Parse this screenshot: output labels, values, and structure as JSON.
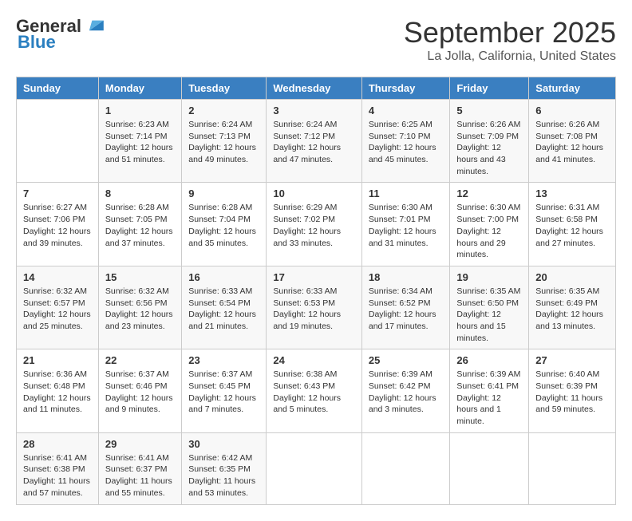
{
  "header": {
    "logo_line1": "General",
    "logo_line2": "Blue",
    "title": "September 2025",
    "subtitle": "La Jolla, California, United States"
  },
  "calendar": {
    "headers": [
      "Sunday",
      "Monday",
      "Tuesday",
      "Wednesday",
      "Thursday",
      "Friday",
      "Saturday"
    ],
    "weeks": [
      [
        {
          "day": "",
          "sunrise": "",
          "sunset": "",
          "daylight": ""
        },
        {
          "day": "1",
          "sunrise": "Sunrise: 6:23 AM",
          "sunset": "Sunset: 7:14 PM",
          "daylight": "Daylight: 12 hours and 51 minutes."
        },
        {
          "day": "2",
          "sunrise": "Sunrise: 6:24 AM",
          "sunset": "Sunset: 7:13 PM",
          "daylight": "Daylight: 12 hours and 49 minutes."
        },
        {
          "day": "3",
          "sunrise": "Sunrise: 6:24 AM",
          "sunset": "Sunset: 7:12 PM",
          "daylight": "Daylight: 12 hours and 47 minutes."
        },
        {
          "day": "4",
          "sunrise": "Sunrise: 6:25 AM",
          "sunset": "Sunset: 7:10 PM",
          "daylight": "Daylight: 12 hours and 45 minutes."
        },
        {
          "day": "5",
          "sunrise": "Sunrise: 6:26 AM",
          "sunset": "Sunset: 7:09 PM",
          "daylight": "Daylight: 12 hours and 43 minutes."
        },
        {
          "day": "6",
          "sunrise": "Sunrise: 6:26 AM",
          "sunset": "Sunset: 7:08 PM",
          "daylight": "Daylight: 12 hours and 41 minutes."
        }
      ],
      [
        {
          "day": "7",
          "sunrise": "Sunrise: 6:27 AM",
          "sunset": "Sunset: 7:06 PM",
          "daylight": "Daylight: 12 hours and 39 minutes."
        },
        {
          "day": "8",
          "sunrise": "Sunrise: 6:28 AM",
          "sunset": "Sunset: 7:05 PM",
          "daylight": "Daylight: 12 hours and 37 minutes."
        },
        {
          "day": "9",
          "sunrise": "Sunrise: 6:28 AM",
          "sunset": "Sunset: 7:04 PM",
          "daylight": "Daylight: 12 hours and 35 minutes."
        },
        {
          "day": "10",
          "sunrise": "Sunrise: 6:29 AM",
          "sunset": "Sunset: 7:02 PM",
          "daylight": "Daylight: 12 hours and 33 minutes."
        },
        {
          "day": "11",
          "sunrise": "Sunrise: 6:30 AM",
          "sunset": "Sunset: 7:01 PM",
          "daylight": "Daylight: 12 hours and 31 minutes."
        },
        {
          "day": "12",
          "sunrise": "Sunrise: 6:30 AM",
          "sunset": "Sunset: 7:00 PM",
          "daylight": "Daylight: 12 hours and 29 minutes."
        },
        {
          "day": "13",
          "sunrise": "Sunrise: 6:31 AM",
          "sunset": "Sunset: 6:58 PM",
          "daylight": "Daylight: 12 hours and 27 minutes."
        }
      ],
      [
        {
          "day": "14",
          "sunrise": "Sunrise: 6:32 AM",
          "sunset": "Sunset: 6:57 PM",
          "daylight": "Daylight: 12 hours and 25 minutes."
        },
        {
          "day": "15",
          "sunrise": "Sunrise: 6:32 AM",
          "sunset": "Sunset: 6:56 PM",
          "daylight": "Daylight: 12 hours and 23 minutes."
        },
        {
          "day": "16",
          "sunrise": "Sunrise: 6:33 AM",
          "sunset": "Sunset: 6:54 PM",
          "daylight": "Daylight: 12 hours and 21 minutes."
        },
        {
          "day": "17",
          "sunrise": "Sunrise: 6:33 AM",
          "sunset": "Sunset: 6:53 PM",
          "daylight": "Daylight: 12 hours and 19 minutes."
        },
        {
          "day": "18",
          "sunrise": "Sunrise: 6:34 AM",
          "sunset": "Sunset: 6:52 PM",
          "daylight": "Daylight: 12 hours and 17 minutes."
        },
        {
          "day": "19",
          "sunrise": "Sunrise: 6:35 AM",
          "sunset": "Sunset: 6:50 PM",
          "daylight": "Daylight: 12 hours and 15 minutes."
        },
        {
          "day": "20",
          "sunrise": "Sunrise: 6:35 AM",
          "sunset": "Sunset: 6:49 PM",
          "daylight": "Daylight: 12 hours and 13 minutes."
        }
      ],
      [
        {
          "day": "21",
          "sunrise": "Sunrise: 6:36 AM",
          "sunset": "Sunset: 6:48 PM",
          "daylight": "Daylight: 12 hours and 11 minutes."
        },
        {
          "day": "22",
          "sunrise": "Sunrise: 6:37 AM",
          "sunset": "Sunset: 6:46 PM",
          "daylight": "Daylight: 12 hours and 9 minutes."
        },
        {
          "day": "23",
          "sunrise": "Sunrise: 6:37 AM",
          "sunset": "Sunset: 6:45 PM",
          "daylight": "Daylight: 12 hours and 7 minutes."
        },
        {
          "day": "24",
          "sunrise": "Sunrise: 6:38 AM",
          "sunset": "Sunset: 6:43 PM",
          "daylight": "Daylight: 12 hours and 5 minutes."
        },
        {
          "day": "25",
          "sunrise": "Sunrise: 6:39 AM",
          "sunset": "Sunset: 6:42 PM",
          "daylight": "Daylight: 12 hours and 3 minutes."
        },
        {
          "day": "26",
          "sunrise": "Sunrise: 6:39 AM",
          "sunset": "Sunset: 6:41 PM",
          "daylight": "Daylight: 12 hours and 1 minute."
        },
        {
          "day": "27",
          "sunrise": "Sunrise: 6:40 AM",
          "sunset": "Sunset: 6:39 PM",
          "daylight": "Daylight: 11 hours and 59 minutes."
        }
      ],
      [
        {
          "day": "28",
          "sunrise": "Sunrise: 6:41 AM",
          "sunset": "Sunset: 6:38 PM",
          "daylight": "Daylight: 11 hours and 57 minutes."
        },
        {
          "day": "29",
          "sunrise": "Sunrise: 6:41 AM",
          "sunset": "Sunset: 6:37 PM",
          "daylight": "Daylight: 11 hours and 55 minutes."
        },
        {
          "day": "30",
          "sunrise": "Sunrise: 6:42 AM",
          "sunset": "Sunset: 6:35 PM",
          "daylight": "Daylight: 11 hours and 53 minutes."
        },
        {
          "day": "",
          "sunrise": "",
          "sunset": "",
          "daylight": ""
        },
        {
          "day": "",
          "sunrise": "",
          "sunset": "",
          "daylight": ""
        },
        {
          "day": "",
          "sunrise": "",
          "sunset": "",
          "daylight": ""
        },
        {
          "day": "",
          "sunrise": "",
          "sunset": "",
          "daylight": ""
        }
      ]
    ]
  }
}
